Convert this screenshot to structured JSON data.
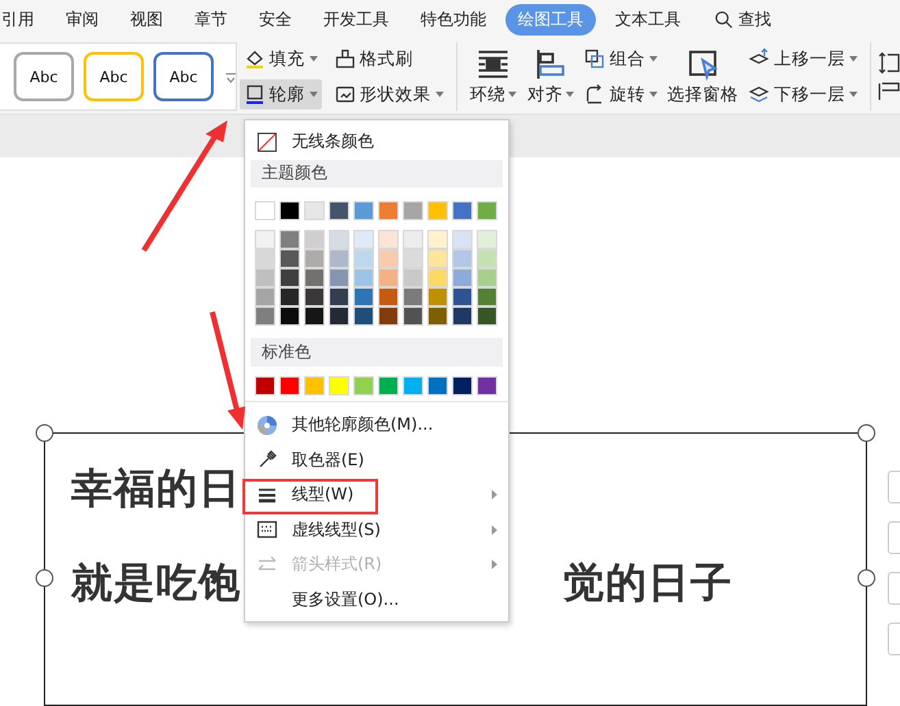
{
  "tabs": [
    {
      "label": "引用",
      "selected": false
    },
    {
      "label": "审阅",
      "selected": false
    },
    {
      "label": "视图",
      "selected": false
    },
    {
      "label": "章节",
      "selected": false
    },
    {
      "label": "安全",
      "selected": false
    },
    {
      "label": "开发工具",
      "selected": false
    },
    {
      "label": "特色功能",
      "selected": false
    },
    {
      "label": "绘图工具",
      "selected": true
    },
    {
      "label": "文本工具",
      "selected": false
    }
  ],
  "search": {
    "label": "查找"
  },
  "ribbon": {
    "gallery": [
      {
        "label": "Abc",
        "color": "#a8a8a8"
      },
      {
        "label": "Abc",
        "color": "#ffc000"
      },
      {
        "label": "Abc",
        "color": "#4472c4"
      }
    ],
    "fill": "填充",
    "format_painter": "格式刷",
    "outline": {
      "label": "轮廓",
      "pressed": true
    },
    "shape_effects": "形状效果",
    "wrap": "环绕",
    "align": "对齐",
    "group": "组合",
    "rotate": "旋转",
    "selection_pane": "选择窗格",
    "bring_forward": "上移一层",
    "send_backward": "下移一层"
  },
  "outline_menu": {
    "no_line": "无线条颜色",
    "theme_header": "主题颜色",
    "theme_colors": [
      {
        "color": "#ffffff"
      },
      {
        "color": "#000000"
      },
      {
        "color": "#e7e6e6"
      },
      {
        "color": "#44546a"
      },
      {
        "color": "#5b9bd5"
      },
      {
        "color": "#ed7d31"
      },
      {
        "color": "#a5a5a5"
      },
      {
        "color": "#ffc000"
      },
      {
        "color": "#4472c4"
      },
      {
        "color": "#70ad47"
      }
    ],
    "shades": [
      [
        {
          "color": "#f2f2f2"
        },
        {
          "color": "#7f7f7f"
        },
        {
          "color": "#d0cece"
        },
        {
          "color": "#d6dce4"
        },
        {
          "color": "#deebf6"
        },
        {
          "color": "#fbe5d5"
        },
        {
          "color": "#ededed"
        },
        {
          "color": "#fff2cc"
        },
        {
          "color": "#dae3f3"
        },
        {
          "color": "#e2efd9"
        }
      ],
      [
        {
          "color": "#d8d8d8"
        },
        {
          "color": "#595959"
        },
        {
          "color": "#aeabab"
        },
        {
          "color": "#adb9ca"
        },
        {
          "color": "#bdd7ee"
        },
        {
          "color": "#f7cbac"
        },
        {
          "color": "#dbdbdb"
        },
        {
          "color": "#fee599"
        },
        {
          "color": "#b4c6e7"
        },
        {
          "color": "#c5e0b3"
        }
      ],
      [
        {
          "color": "#bfbfbf"
        },
        {
          "color": "#3f3f3f"
        },
        {
          "color": "#757070"
        },
        {
          "color": "#8496b0"
        },
        {
          "color": "#9dc3e6"
        },
        {
          "color": "#f4b183"
        },
        {
          "color": "#c9c9c9"
        },
        {
          "color": "#ffd965"
        },
        {
          "color": "#8eaadb"
        },
        {
          "color": "#a8d08d"
        }
      ],
      [
        {
          "color": "#a5a5a5"
        },
        {
          "color": "#262626"
        },
        {
          "color": "#3a3838"
        },
        {
          "color": "#323f4f"
        },
        {
          "color": "#2e75b5"
        },
        {
          "color": "#c55a11"
        },
        {
          "color": "#7b7b7b"
        },
        {
          "color": "#bf9000"
        },
        {
          "color": "#2f5496"
        },
        {
          "color": "#538135"
        }
      ],
      [
        {
          "color": "#7f7f7f"
        },
        {
          "color": "#0c0c0c"
        },
        {
          "color": "#171616"
        },
        {
          "color": "#222a35"
        },
        {
          "color": "#1e4e79"
        },
        {
          "color": "#833c0b"
        },
        {
          "color": "#525252"
        },
        {
          "color": "#7f6000"
        },
        {
          "color": "#1f3864"
        },
        {
          "color": "#375623"
        }
      ]
    ],
    "standard_header": "标准色",
    "standard_colors": [
      {
        "color": "#c00000"
      },
      {
        "color": "#ff0000"
      },
      {
        "color": "#ffc000"
      },
      {
        "color": "#ffff00"
      },
      {
        "color": "#92d050"
      },
      {
        "color": "#00b050"
      },
      {
        "color": "#00b0f0"
      },
      {
        "color": "#0070c0"
      },
      {
        "color": "#002060"
      },
      {
        "color": "#7030a0"
      }
    ],
    "items": [
      {
        "label": "其他轮廓颜色(M)...",
        "submenu": false,
        "disabled": false,
        "highlighted": false
      },
      {
        "label": "取色器(E)",
        "submenu": false,
        "disabled": false,
        "highlighted": false
      },
      {
        "label": "线型(W)",
        "submenu": true,
        "disabled": false,
        "highlighted": true
      },
      {
        "label": "虚线线型(S)",
        "submenu": true,
        "disabled": false,
        "highlighted": false
      },
      {
        "label": "箭头样式(R)",
        "submenu": true,
        "disabled": true,
        "highlighted": false
      },
      {
        "label": "更多设置(O)...",
        "submenu": false,
        "disabled": false,
        "highlighted": false
      }
    ]
  },
  "document": {
    "line_1": "幸福的日",
    "line_2_left": "就是吃饱",
    "line_2_right": "觉的日子"
  }
}
